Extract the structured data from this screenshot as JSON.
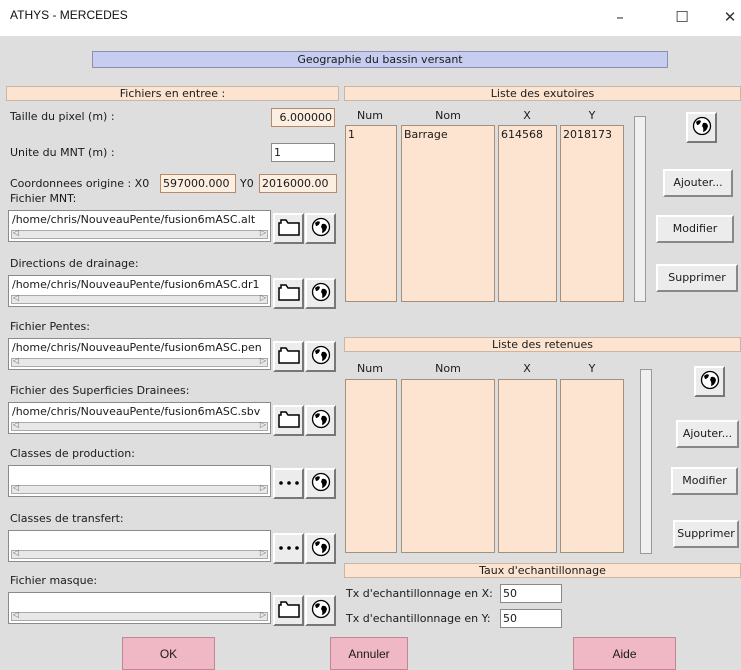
{
  "window": {
    "title": "ATHYS - MERCEDES",
    "min": "–",
    "max": "☐",
    "close": "✕"
  },
  "header": {
    "title": "Geographie du bassin versant"
  },
  "left": {
    "section_title": "Fichiers en entree :",
    "pixel_label": "Taille du pixel (m) :",
    "pixel_value": "6.000000",
    "unite_label": "Unite du MNT (m) :",
    "unite_value": "1",
    "coord_label": "Coordonnees origine : X0",
    "x0_value": "597000.000",
    "y0_label": "Y0",
    "y0_value": "2016000.00",
    "files": [
      {
        "label": "Fichier MNT:",
        "value": "/home/chris/NouveauPente/fusion6mASC.alt",
        "icon": "folder"
      },
      {
        "label": "Directions de drainage:",
        "value": "/home/chris/NouveauPente/fusion6mASC.dr1",
        "icon": "folder"
      },
      {
        "label": "Fichier Pentes:",
        "value": "/home/chris/NouveauPente/fusion6mASC.pen",
        "icon": "folder"
      },
      {
        "label": "Fichier des Superficies Drainees:",
        "value": "/home/chris/NouveauPente/fusion6mASC.sbv",
        "icon": "folder"
      },
      {
        "label": "Classes de production:",
        "value": "",
        "icon": "dots"
      },
      {
        "label": "Classes de transfert:",
        "value": "",
        "icon": "dots"
      },
      {
        "label": "Fichier masque:",
        "value": "",
        "icon": "folder"
      }
    ]
  },
  "exutoires": {
    "title": "Liste des exutoires",
    "col_num": "Num",
    "col_nom": "Nom",
    "col_x": "X",
    "col_y": "Y",
    "row": {
      "num": "1",
      "nom": "Barrage",
      "x": "614568",
      "y": "2018173"
    },
    "add": "Ajouter...",
    "modify": "Modifier",
    "delete": "Supprimer"
  },
  "retenues": {
    "title": "Liste des retenues",
    "col_num": "Num",
    "col_nom": "Nom",
    "col_x": "X",
    "col_y": "Y",
    "add": "Ajouter...",
    "modify": "Modifier",
    "delete": "Supprimer"
  },
  "taux": {
    "title": "Taux d'echantillonnage",
    "x_label": "Tx d'echantillonnage en X:",
    "x_value": "50",
    "y_label": "Tx d'echantillonnage en Y:",
    "y_value": "50"
  },
  "bottom": {
    "ok": "OK",
    "cancel": "Annuler",
    "help": "Aide"
  }
}
